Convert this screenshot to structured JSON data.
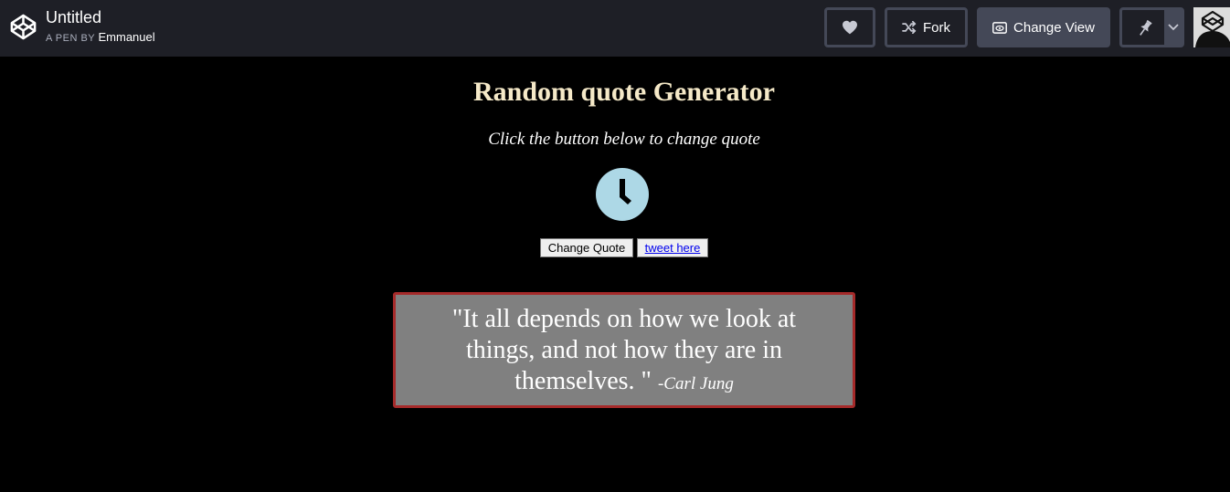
{
  "header": {
    "title": "Untitled",
    "by_prefix": "A PEN BY",
    "author": "Emmanuel",
    "fork_label": "Fork",
    "change_view_label": "Change View"
  },
  "icons": {
    "logo": "codepen-logo-icon",
    "heart": "heart-icon",
    "fork": "fork-icon",
    "view": "eye-icon",
    "pin": "pin-icon",
    "chevron": "chevron-down-icon",
    "clock": "clock-icon"
  },
  "colors": {
    "topbar_bg": "#1e1f26",
    "button_border": "#444857",
    "title_color": "#f5e9c8",
    "clock_bg": "#add8e6",
    "quote_bg": "#808080",
    "quote_border": "#a52a2a"
  },
  "main": {
    "title": "Random quote Generator",
    "subtitle": "Click the button below to change quote",
    "change_quote_label": "Change Quote",
    "tweet_label": "tweet here",
    "quote_text": "\"It all depends on how we look at things, and not how they are in themselves. \"",
    "quote_author": "-Carl Jung"
  }
}
